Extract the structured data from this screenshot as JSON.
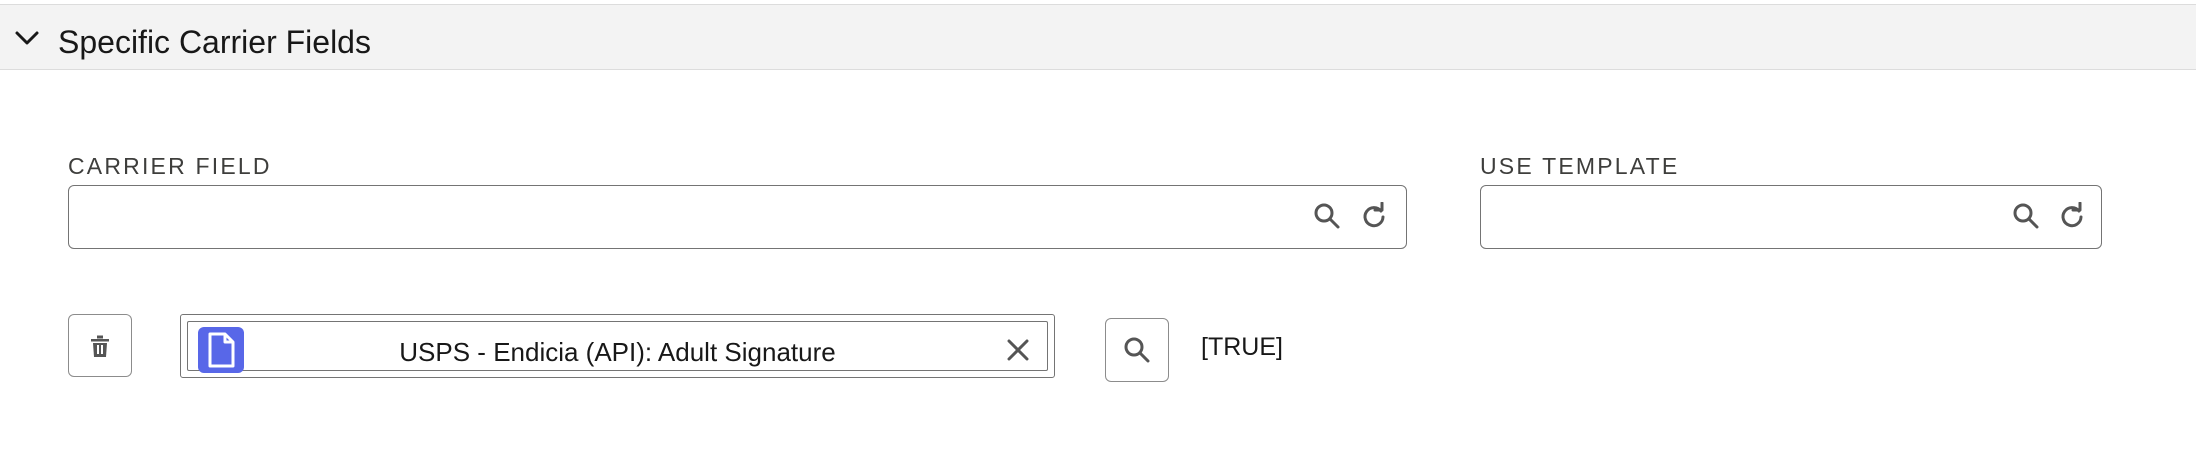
{
  "section": {
    "title": "Specific Carrier Fields",
    "toggle_icon": "chevron-down-icon"
  },
  "carrier_field": {
    "label": "CARRIER FIELD",
    "value": "",
    "placeholder": "",
    "icons": [
      "search-icon",
      "refresh-icon"
    ]
  },
  "use_template": {
    "label": "USE TEMPLATE",
    "value": "",
    "placeholder": "",
    "icons": [
      "search-icon",
      "refresh-icon"
    ]
  },
  "row": {
    "delete_icon": "trash-icon",
    "selected_item": {
      "icon": "document-icon",
      "label": "USPS - Endicia (API): Adult Signature",
      "remove_icon": "close-icon"
    },
    "search_icon": "search-icon",
    "value": "[TRUE]"
  },
  "colors": {
    "header_bg": "#f3f3f3",
    "border": "#747474",
    "pill_icon": "#5867e8",
    "text": "#181818"
  }
}
